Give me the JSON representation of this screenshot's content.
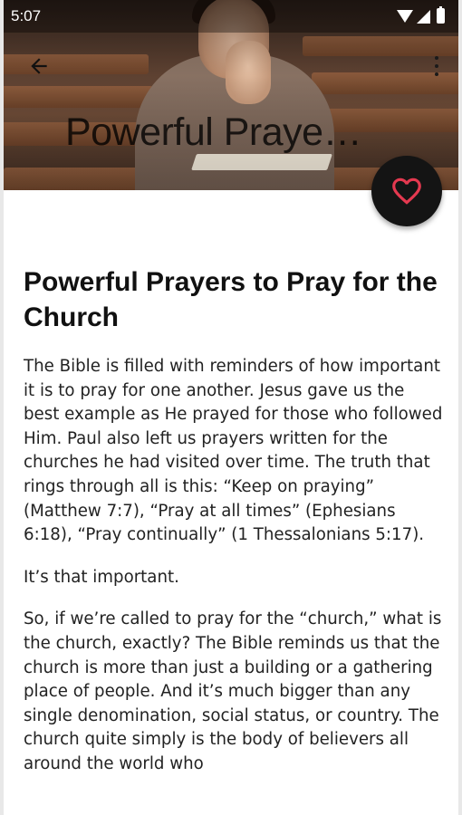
{
  "status_bar": {
    "time": "5:07",
    "icons": [
      "wifi-icon",
      "signal-icon",
      "battery-icon"
    ]
  },
  "toolbar": {
    "back_icon": "arrow-left-icon",
    "collapsed_title": "Powerful Prayers to Pray for the Church",
    "more_icon": "more-vert-icon"
  },
  "hero": {
    "image": "person-praying-in-church-pews"
  },
  "fab": {
    "icon": "heart-outline-icon",
    "accent": "#e53950"
  },
  "article": {
    "title": "Powerful Prayers to Pray for the Church",
    "paragraphs": [
      "The Bible is filled with reminders of how important it is to pray for one another. Jesus gave us the best example as He prayed for those who followed Him. Paul also left us prayers written for the churches he had visited over time. The truth that rings through all is this: “Keep on praying” (Matthew 7:7), “Pray at all times” (Ephesians 6:18), “Pray continually” (1 Thessalonians 5:17).",
      "It’s that important.",
      "So, if we’re called to pray for the “church,” what is the church, exactly? The Bible reminds us that the church is more than just a building or a gathering place of people. And it’s much bigger than any single denomination, social status, or country. The church quite simply is the body of believers all around the world who"
    ]
  }
}
